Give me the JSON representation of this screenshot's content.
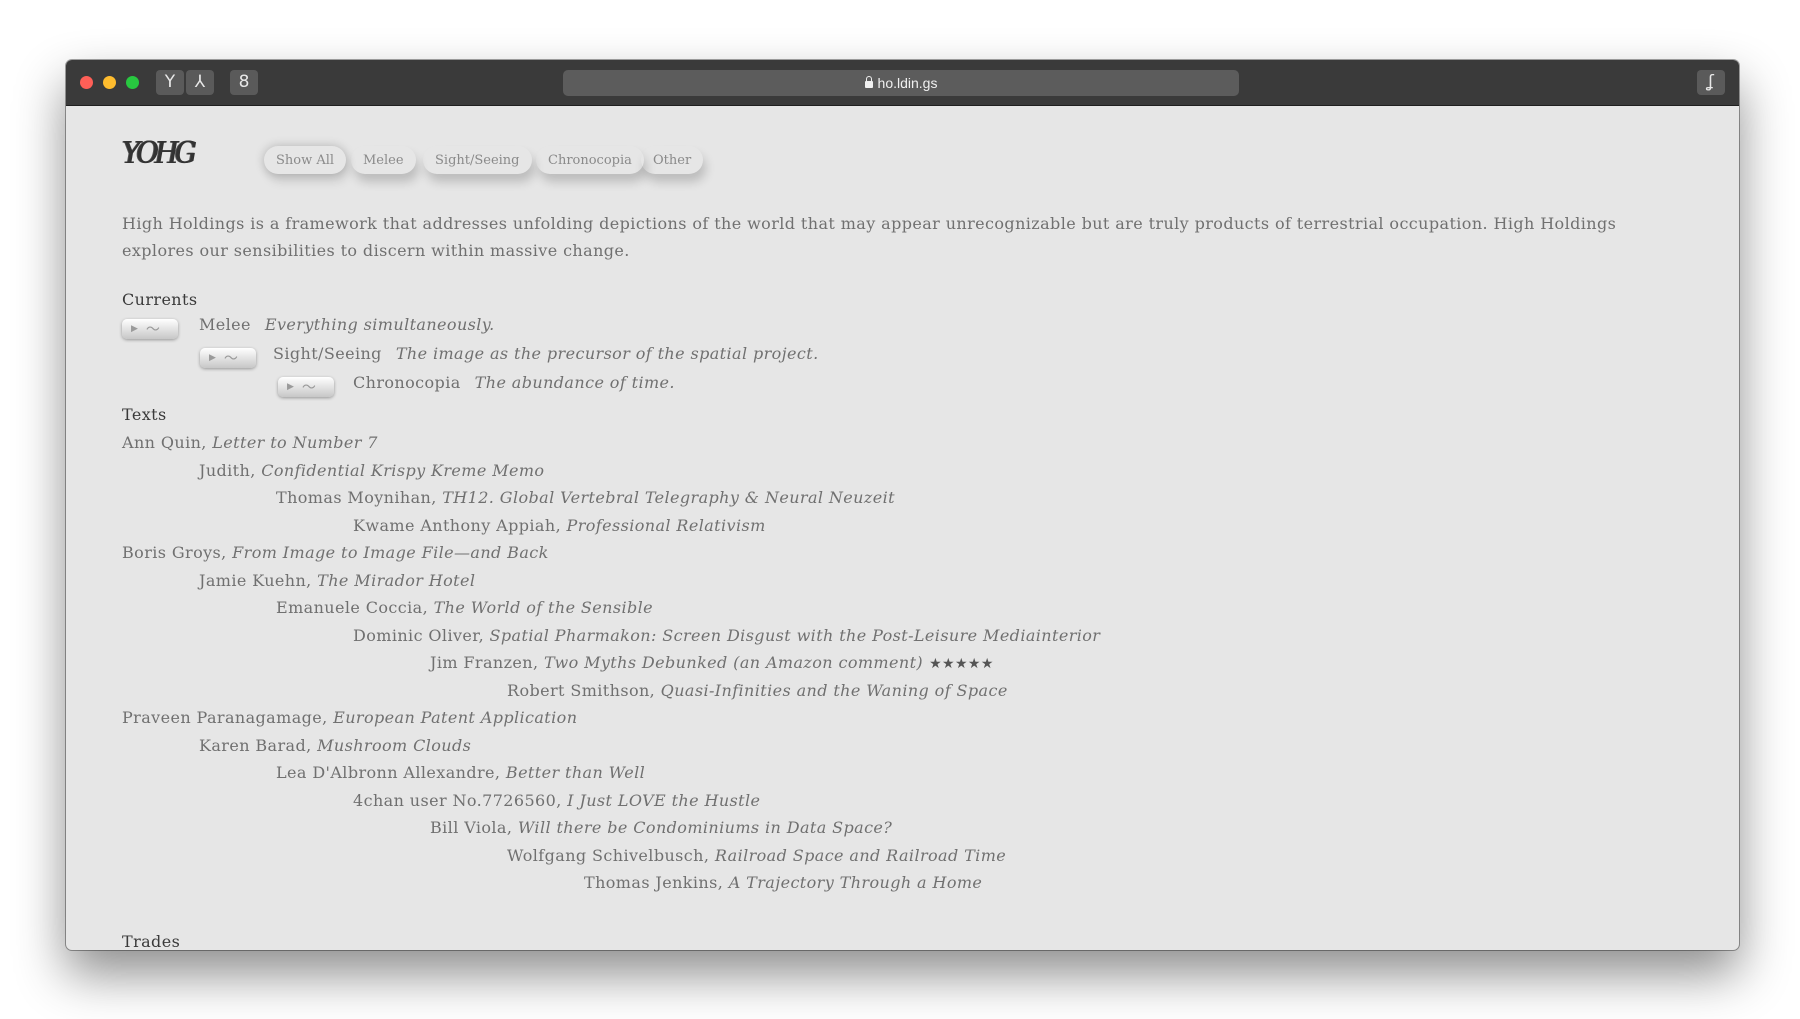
{
  "browser": {
    "url": "ho.ldin.gs",
    "toolbar_glyphs": [
      "Y",
      "⅄",
      "8"
    ],
    "right_glyph": "ʆ"
  },
  "site": {
    "logo_text": "YOHG",
    "filters": [
      "Show All",
      "Melee",
      "Sight/Seeing",
      "Chronocopia",
      "Other"
    ],
    "intro": "High Holdings is a framework that addresses unfolding depictions of the world that may appear unrecognizable but are truly products of terrestrial occupation. High Holdings explores our sensibilities to discern within massive change.",
    "currents_heading": "Currents",
    "currents": [
      {
        "title": "Melee",
        "desc": "Everything simultaneously."
      },
      {
        "title": "Sight/Seeing",
        "desc": "The image as the precursor of the spatial project."
      },
      {
        "title": "Chronocopia",
        "desc": "The abundance of time."
      }
    ],
    "texts_heading": "Texts",
    "texts": [
      {
        "author": "Ann Quin, ",
        "title": "Letter to Number 7",
        "extra": ""
      },
      {
        "author": "Judith, ",
        "title": "Confidential Krispy Kreme Memo",
        "extra": ""
      },
      {
        "author": "Thomas Moynihan, ",
        "title": "TH12. Global Vertebral Telegraphy & Neural Neuzeit",
        "extra": ""
      },
      {
        "author": "Kwame Anthony Appiah, ",
        "title": "Professional Relativism",
        "extra": ""
      },
      {
        "author": "Boris Groys, ",
        "title": "From Image to Image File—and Back",
        "extra": ""
      },
      {
        "author": "Jamie Kuehn, ",
        "title": "The Mirador Hotel",
        "extra": ""
      },
      {
        "author": "Emanuele Coccia, ",
        "title": "The World of the Sensible",
        "extra": ""
      },
      {
        "author": "Dominic Oliver, ",
        "title": "Spatial Pharmakon: Screen Disgust with the Post-Leisure Mediainterior",
        "extra": ""
      },
      {
        "author": "Jim Franzen, ",
        "title": "Two Myths Debunked (an Amazon comment)",
        "extra": "★★★★★"
      },
      {
        "author": "Robert Smithson, ",
        "title": "Quasi-Infinities and the Waning of Space",
        "extra": ""
      },
      {
        "author": "Praveen Paranagamage, ",
        "title": "European Patent Application",
        "extra": ""
      },
      {
        "author": "Karen Barad, ",
        "title": "Mushroom Clouds",
        "extra": ""
      },
      {
        "author": "Lea D'Albronn Allexandre, ",
        "title": "Better than Well",
        "extra": ""
      },
      {
        "author": "4chan user No.7726560, ",
        "title": "I Just LOVE the Hustle",
        "extra": ""
      },
      {
        "author": "Bill Viola, ",
        "title": "Will there be Condominiums in Data Space?",
        "extra": ""
      },
      {
        "author": "Wolfgang Schivelbusch, ",
        "title": "Railroad Space and Railroad Time",
        "extra": ""
      },
      {
        "author": "Thomas Jenkins, ",
        "title": "A Trajectory Through a Home",
        "extra": ""
      }
    ],
    "trades_heading": "Trades",
    "pill_glyphs": {
      "play": "▶",
      "wave": "〜"
    }
  }
}
